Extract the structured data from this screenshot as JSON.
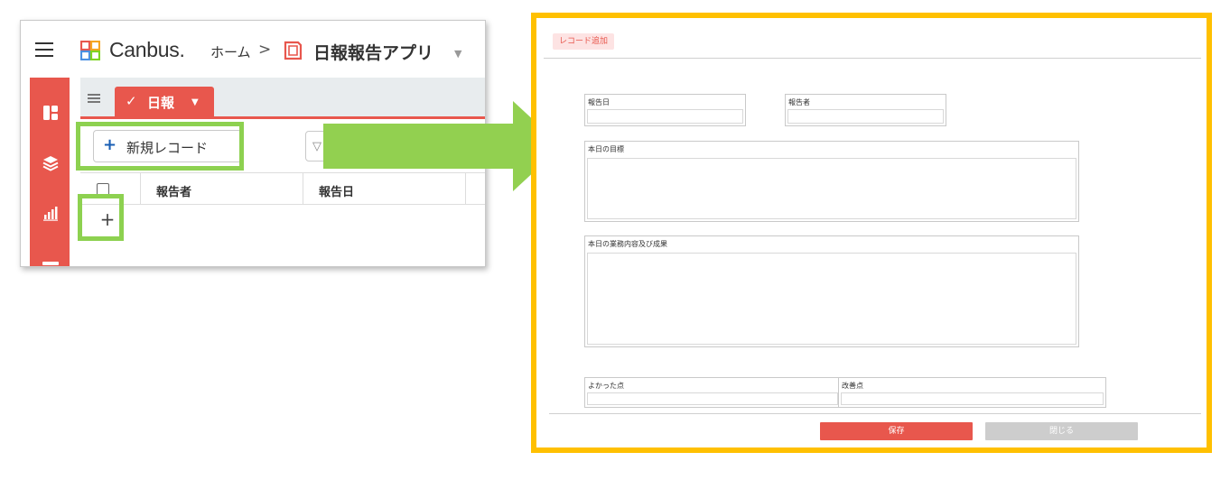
{
  "app_screen": {
    "brand": "Canbus.",
    "breadcrumb": {
      "home": "ホーム",
      "separator": ">",
      "app": "日報報告アプリ"
    },
    "view_tab": {
      "label": "日報"
    },
    "toolbar": {
      "new_record_plus": "+",
      "new_record_label": "新規レコード"
    },
    "table": {
      "columns": [
        "報告者",
        "報告日"
      ]
    },
    "row_add": "+"
  },
  "dialog": {
    "title": "レコード追加",
    "fields": {
      "report_date": "報告日",
      "reporter": "報告者",
      "todays_goal": "本日の目標",
      "work_and_results": "本日の業務内容及び成果",
      "good_points": "よかった点",
      "improvements": "改善点"
    },
    "buttons": {
      "save": "保存",
      "close": "閉じる"
    }
  },
  "colors": {
    "brand_red": "#e8574d",
    "highlight_green": "#8dd150",
    "arrow_green": "#92d050",
    "dialog_border": "#ffc000"
  },
  "icons": {
    "menu": "hamburger-icon",
    "logo": "canbus-logo-icon",
    "app": "app-icon",
    "sidebar": [
      "dashboard-icon",
      "layers-icon",
      "chart-icon"
    ],
    "filter": "filter-icon",
    "check": "check-icon"
  }
}
